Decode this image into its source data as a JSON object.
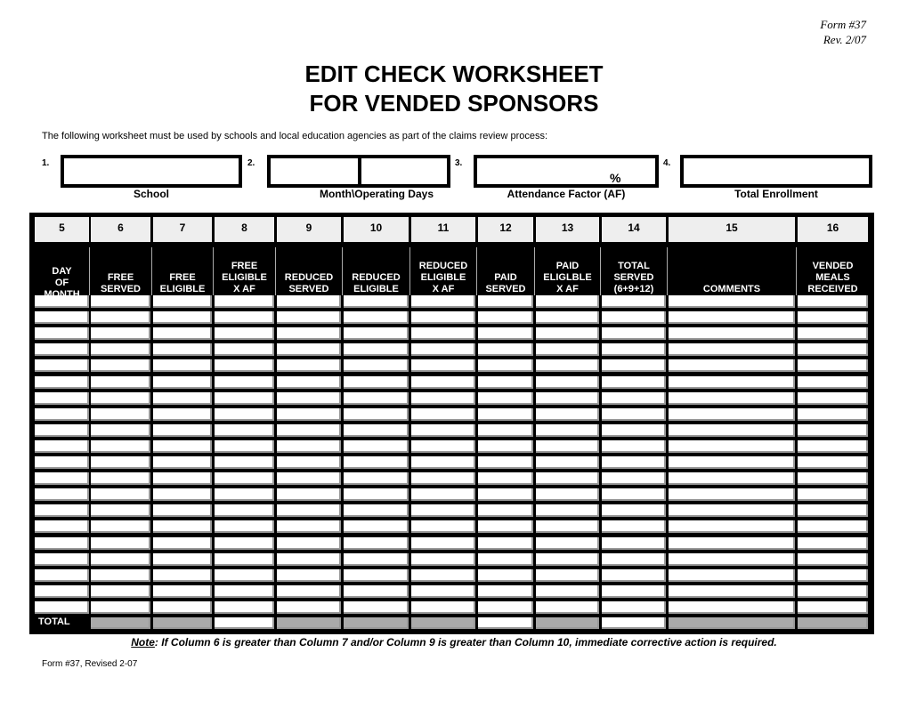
{
  "header": {
    "form_number": "Form #37",
    "revision": "Rev. 2/07",
    "title_line1": "EDIT CHECK WORKSHEET",
    "title_line2": "FOR VENDED SPONSORS",
    "intro": "The following worksheet must be used by schools and local education agencies as part of the claims review process:"
  },
  "fields": [
    {
      "number": "1.",
      "label": "School",
      "value": ""
    },
    {
      "number": "2.",
      "label": "Month\\Operating Days",
      "month_value": "",
      "days_value": ""
    },
    {
      "number": "3.",
      "label": "Attendance Factor (AF)",
      "value": "",
      "suffix": "%"
    },
    {
      "number": "4.",
      "label": "Total Enrollment",
      "value": ""
    }
  ],
  "table": {
    "columns": [
      {
        "number": "5",
        "label": "DAY\nOF\nMONTH"
      },
      {
        "number": "6",
        "label": "FREE\nSERVED"
      },
      {
        "number": "7",
        "label": "FREE\nELIGIBLE"
      },
      {
        "number": "8",
        "label": "FREE\nELIGIBLE\nX AF"
      },
      {
        "number": "9",
        "label": "REDUCED\nSERVED"
      },
      {
        "number": "10",
        "label": "REDUCED\nELIGIBLE"
      },
      {
        "number": "11",
        "label": "REDUCED\nELIGIBLE\nX AF"
      },
      {
        "number": "12",
        "label": "PAID\nSERVED"
      },
      {
        "number": "13",
        "label": "PAID\nELIGLBLE\nX AF"
      },
      {
        "number": "14",
        "label": "TOTAL\nSERVED\n(6+9+12)"
      },
      {
        "number": "15",
        "label": "COMMENTS"
      },
      {
        "number": "16",
        "label": "VENDED\nMEALS\nRECEIVED"
      }
    ],
    "row_count": 20,
    "rows": [],
    "total_label": "TOTAL",
    "total_row_shaded": [
      false,
      true,
      true,
      false,
      true,
      true,
      true,
      false,
      true,
      false,
      true,
      true
    ]
  },
  "note": {
    "prefix": "Note",
    "text": ":  If Column 6 is greater than Column 7 and/or Column 9 is greater than Column 10, immediate corrective action is required."
  },
  "footer": "Form #37, Revised 2-07"
}
